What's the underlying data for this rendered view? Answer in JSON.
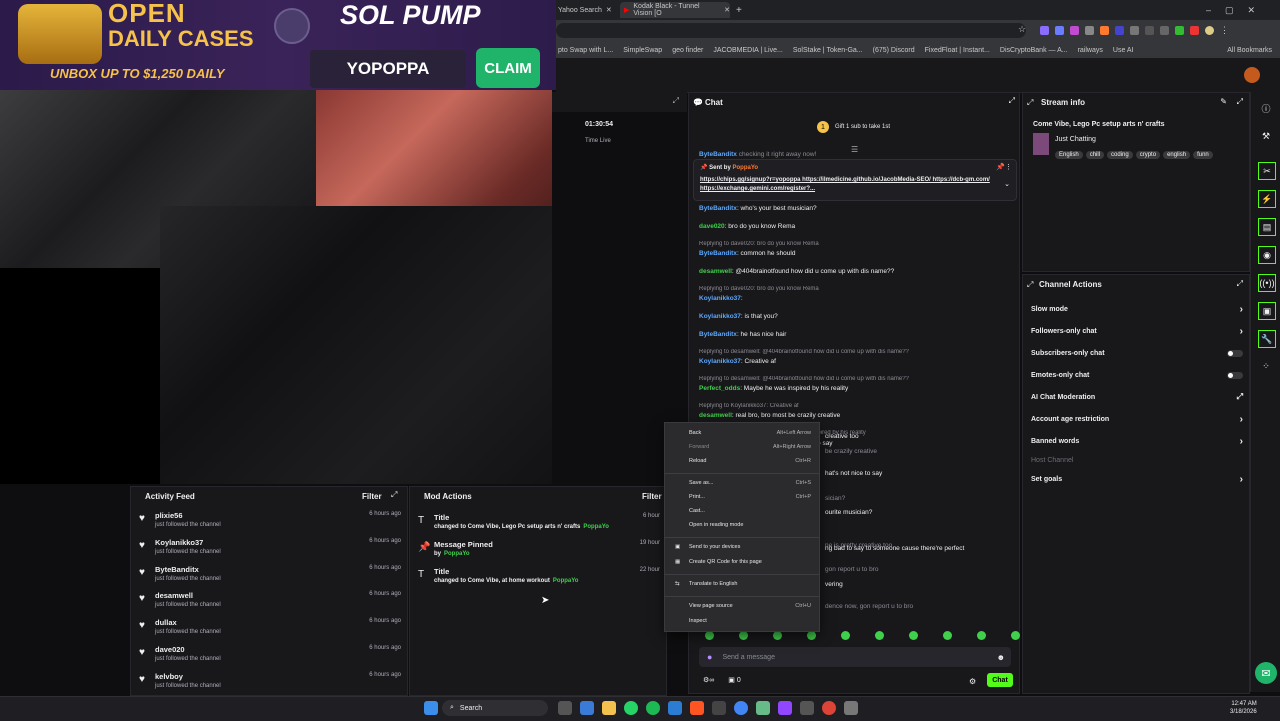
{
  "browser": {
    "tabs": [
      "Yahoo Search",
      "Kodak Black - Tunnel Vision [O"
    ],
    "bookmarks": [
      "pto Swap with L...",
      "SimpleSwap",
      "geo finder",
      "JACOBMEDIA | Live...",
      "SolStake | Token-Ga...",
      "(675) Discord",
      "FixedFloat | Instant...",
      "DisCryptoBank — A...",
      "railways",
      "Use AI",
      "All Bookmarks"
    ]
  },
  "banner": {
    "open": "OPEN",
    "daily_cases": "DAILY CASES",
    "unbox": "UNBOX UP TO $1,250 DAILY",
    "brand": "SOL PUMP",
    "code": "YOPOPPA",
    "claim": "CLAIM"
  },
  "stats": {
    "uptime": "01:30:54",
    "uptime_label": "Time Live"
  },
  "activity_feed": {
    "title": "Activity Feed",
    "filter": "Filter",
    "items": [
      {
        "name": "plixie56",
        "sub": "just followed the channel",
        "time": "6 hours ago"
      },
      {
        "name": "Koylanikko37",
        "sub": "just followed the channel",
        "time": "6 hours ago"
      },
      {
        "name": "ByteBanditx",
        "sub": "just followed the channel",
        "time": "6 hours ago"
      },
      {
        "name": "desamwell",
        "sub": "just followed the channel",
        "time": "6 hours ago"
      },
      {
        "name": "dullax",
        "sub": "just followed the channel",
        "time": "6 hours ago"
      },
      {
        "name": "dave020",
        "sub": "just followed the channel",
        "time": "6 hours ago"
      },
      {
        "name": "kelvboy",
        "sub": "just followed the channel",
        "time": "6 hours ago"
      }
    ]
  },
  "mod_actions": {
    "title": "Mod Actions",
    "filter": "Filter",
    "items": [
      {
        "title": "Title",
        "sub": "changed to Come Vibe, Lego Pc setup arts n' crafts",
        "by": "PoppaYo",
        "time": "6 hour"
      },
      {
        "title": "Message Pinned",
        "sub": "by",
        "by": "PoppaYo",
        "time": "19 hour"
      },
      {
        "title": "Title",
        "sub": "changed to Come Vibe, at home workout",
        "by": "PoppaYo",
        "time": "22 hour"
      }
    ]
  },
  "chat": {
    "title": "Chat",
    "gift": "Gift 1 sub to take 1st",
    "pinned_by": "Sent by",
    "pinned_user": "PoppaYo",
    "pinned_text": "https://chips.gg/signup?r=yopoppa https://ilmedicine.github.io/JacobMedia-SEO/ https://dcb-gm.com/ https://exchange.gemini.com/register?...",
    "partial_top": "checking it right away now!",
    "lines": [
      {
        "reply": "",
        "user": "ByteBanditx",
        "text": ": who's your best musician?",
        "c": "u-blue"
      },
      {
        "reply": "",
        "user": "dave020",
        "text": ": bro do you know Rema",
        "c": "u-green"
      },
      {
        "reply": "Replying to dave020: bro do you know Rema",
        "user": "ByteBanditx",
        "text": ": common he should",
        "c": "u-blue"
      },
      {
        "reply": "",
        "user": "desamwell",
        "text": ": @404brainotfound how did u come up with dis name??",
        "c": "u-green"
      },
      {
        "reply": "Replying to dave020: bro do you know Rema",
        "user": "Koylanikko37",
        "text": ":",
        "c": "u-blue"
      },
      {
        "reply": "",
        "user": "Koylanikko37",
        "text": ": is that you?",
        "c": "u-blue"
      },
      {
        "reply": "",
        "user": "ByteBanditx",
        "text": ": he has nice hair",
        "c": "u-blue"
      },
      {
        "reply": "Replying to desamwell: @404brainotfound how did u come up with dis name??",
        "user": "Koylanikko37",
        "text": ": Creative af",
        "c": "u-blue"
      },
      {
        "reply": "Replying to desamwell: @404brainotfound how did u come up with dis name??",
        "user": "Perfect_odds",
        "text": ": Maybe he was inspired by his reality",
        "c": "u-green"
      },
      {
        "reply": "Replying to Koylanikko37: Creative af",
        "user": "desamwell",
        "text": ": real bro, bro most be crazily creative",
        "c": "u-green"
      },
      {
        "reply": "Replying to Perfect_odds: Maybe he was inspired by his reality",
        "user": "desamwell",
        "text": ": wtf 😂😂😂, that's not nice to say",
        "c": "u-green"
      }
    ],
    "hidden": [
      "creative too",
      "be crazily creative",
      "hat's not nice to say",
      "sician?",
      "ourite musician?",
      "ne is pretty creative too",
      "ng bad to say to someone cause there're perfect",
      "gon report u to bro",
      "vering",
      "dence now, gon report u to bro"
    ],
    "input_placeholder": "Send a message",
    "points": "0",
    "send": "Chat"
  },
  "context_menu": [
    {
      "label": "Back",
      "key": "Alt+Left Arrow"
    },
    {
      "label": "Forward",
      "key": "Alt+Right Arrow"
    },
    {
      "label": "Reload",
      "key": "Ctrl+R"
    },
    {
      "label": "Save as...",
      "key": "Ctrl+S"
    },
    {
      "label": "Print...",
      "key": "Ctrl+P"
    },
    {
      "label": "Cast...",
      "key": ""
    },
    {
      "label": "Open in reading mode",
      "key": ""
    },
    {
      "label": "Send to your devices",
      "key": ""
    },
    {
      "label": "Create QR Code for this page",
      "key": ""
    },
    {
      "label": "Translate to English",
      "key": ""
    },
    {
      "label": "View page source",
      "key": "Ctrl+U"
    },
    {
      "label": "Inspect",
      "key": ""
    }
  ],
  "stream_info": {
    "title": "Stream info",
    "stream_title": "Come Vibe, Lego Pc setup arts n' crafts",
    "category": "Just Chatting",
    "tags": [
      "English",
      "chill",
      "coding",
      "crypto",
      "english",
      "funn"
    ]
  },
  "channel_actions": {
    "title": "Channel Actions",
    "rows": [
      "Slow mode",
      "Followers-only chat",
      "Subscribers-only chat",
      "Emotes-only chat",
      "AI Chat Moderation",
      "Account age restriction",
      "Banned words",
      "Host Channel",
      "Set goals"
    ]
  },
  "taskbar": {
    "search": "Search",
    "time": "12:47 AM",
    "date": "3/18/2026"
  },
  "colors": {
    "accent": "#53fc18",
    "brand_gold": "#f6c24a",
    "claim": "#20b46a"
  }
}
